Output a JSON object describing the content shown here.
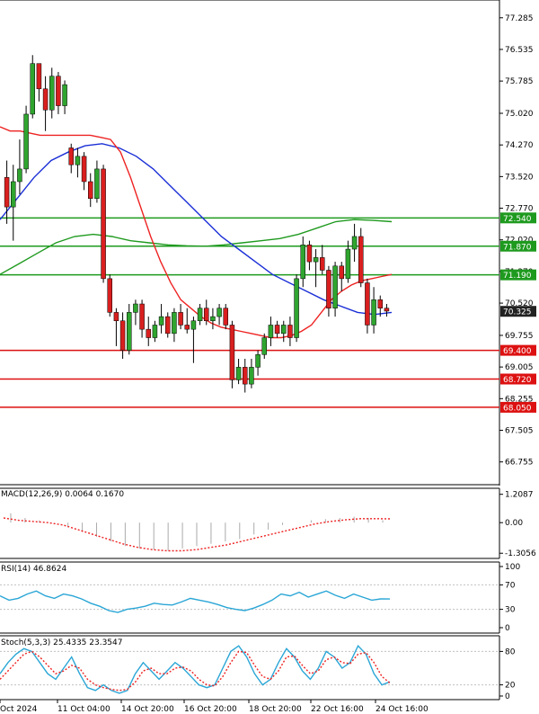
{
  "chart_data": [
    {
      "type": "candlestick",
      "panel": "price",
      "y_ticks": [
        "77.285",
        "76.535",
        "75.785",
        "75.020",
        "74.270",
        "73.520",
        "72.770",
        "72.020",
        "71.270",
        "70.520",
        "69.755",
        "69.005",
        "68.255",
        "67.505",
        "66.755"
      ],
      "ylim": [
        66.3,
        77.6
      ],
      "current_price": {
        "value": 70.325,
        "label": "70.325"
      },
      "support_lines": [
        {
          "value": 69.4,
          "label": "69.400"
        },
        {
          "value": 68.72,
          "label": "68.720"
        },
        {
          "value": 68.05,
          "label": "68.050"
        }
      ],
      "resistance_lines": [
        {
          "value": 72.54,
          "label": "72.540"
        },
        {
          "value": 71.87,
          "label": "71.870"
        },
        {
          "value": 71.19,
          "label": "71.190"
        }
      ],
      "candles": [
        [
          73.5,
          73.9,
          72.4,
          72.8
        ],
        [
          72.8,
          73.8,
          72.0,
          73.4
        ],
        [
          73.4,
          74.4,
          73.1,
          73.7
        ],
        [
          73.7,
          75.2,
          73.6,
          75.0
        ],
        [
          75.0,
          76.4,
          74.9,
          76.2
        ],
        [
          76.2,
          76.2,
          75.3,
          75.6
        ],
        [
          75.6,
          75.9,
          74.6,
          75.1
        ],
        [
          75.1,
          76.1,
          74.9,
          75.9
        ],
        [
          75.9,
          76.0,
          75.0,
          75.2
        ],
        [
          75.2,
          75.8,
          75.0,
          75.7
        ],
        [
          74.2,
          74.3,
          73.6,
          73.8
        ],
        [
          73.8,
          74.2,
          73.5,
          74.0
        ],
        [
          74.0,
          74.1,
          73.2,
          73.4
        ],
        [
          73.4,
          73.6,
          72.8,
          73.0
        ],
        [
          73.0,
          73.9,
          72.9,
          73.7
        ],
        [
          73.7,
          73.8,
          71.0,
          71.1
        ],
        [
          71.1,
          71.2,
          70.2,
          70.3
        ],
        [
          70.3,
          70.4,
          69.5,
          70.1
        ],
        [
          70.1,
          70.3,
          69.2,
          69.4
        ],
        [
          69.4,
          70.5,
          69.3,
          70.3
        ],
        [
          70.3,
          70.6,
          70.0,
          70.5
        ],
        [
          70.5,
          70.6,
          69.7,
          69.9
        ],
        [
          69.9,
          70.2,
          69.5,
          69.7
        ],
        [
          69.7,
          70.1,
          69.6,
          70.0
        ],
        [
          70.0,
          70.5,
          69.8,
          70.2
        ],
        [
          70.2,
          70.3,
          69.7,
          69.8
        ],
        [
          69.8,
          70.4,
          69.6,
          70.3
        ],
        [
          70.3,
          70.5,
          69.9,
          70.0
        ],
        [
          70.0,
          70.4,
          69.8,
          69.9
        ],
        [
          69.9,
          70.2,
          69.1,
          70.1
        ],
        [
          70.1,
          70.5,
          70.0,
          70.4
        ],
        [
          70.4,
          70.6,
          70.0,
          70.1
        ],
        [
          70.1,
          70.4,
          69.9,
          70.2
        ],
        [
          70.2,
          70.5,
          70.0,
          70.4
        ],
        [
          70.4,
          70.5,
          69.9,
          70.0
        ],
        [
          70.0,
          70.1,
          68.5,
          68.7
        ],
        [
          68.7,
          69.2,
          68.6,
          69.0
        ],
        [
          69.0,
          69.2,
          68.4,
          68.6
        ],
        [
          68.6,
          69.2,
          68.5,
          69.0
        ],
        [
          69.0,
          69.4,
          68.8,
          69.3
        ],
        [
          69.3,
          69.8,
          69.2,
          69.7
        ],
        [
          69.7,
          70.2,
          69.5,
          70.0
        ],
        [
          70.0,
          70.1,
          69.7,
          69.8
        ],
        [
          69.8,
          70.1,
          69.6,
          70.0
        ],
        [
          70.0,
          70.2,
          69.5,
          69.7
        ],
        [
          69.7,
          71.2,
          69.6,
          71.1
        ],
        [
          71.1,
          72.1,
          70.9,
          71.9
        ],
        [
          71.9,
          72.0,
          71.3,
          71.5
        ],
        [
          71.5,
          71.8,
          70.9,
          71.6
        ],
        [
          71.6,
          71.9,
          71.2,
          71.3
        ],
        [
          71.3,
          71.4,
          70.2,
          70.4
        ],
        [
          70.4,
          71.5,
          70.2,
          71.4
        ],
        [
          71.4,
          71.5,
          70.8,
          71.1
        ],
        [
          71.1,
          72.0,
          71.0,
          71.8
        ],
        [
          71.8,
          72.4,
          71.5,
          72.1
        ],
        [
          72.1,
          72.3,
          70.9,
          71.0
        ],
        [
          71.0,
          71.1,
          69.8,
          70.0
        ],
        [
          70.0,
          70.9,
          69.8,
          70.6
        ],
        [
          70.6,
          70.7,
          70.2,
          70.4
        ],
        [
          70.4,
          70.5,
          70.2,
          70.33
        ]
      ],
      "ma_red": [
        74.7,
        74.6,
        74.6,
        74.55,
        74.5,
        74.5,
        74.5,
        74.5,
        74.5,
        74.5,
        74.45,
        74.4,
        74.1,
        73.5,
        72.8,
        72.1,
        71.5,
        71.0,
        70.6,
        70.4,
        70.2,
        70.05,
        69.95,
        69.9,
        69.85,
        69.8,
        69.75,
        69.7,
        69.7,
        69.75,
        69.85,
        70.0,
        70.3,
        70.6,
        70.8,
        70.95,
        71.05,
        71.1,
        71.15,
        71.2
      ],
      "ma_blue": [
        72.5,
        73.0,
        73.5,
        73.9,
        74.1,
        74.25,
        74.3,
        74.2,
        74.0,
        73.7,
        73.3,
        72.9,
        72.5,
        72.1,
        71.8,
        71.5,
        71.2,
        71.0,
        70.8,
        70.6,
        70.45,
        70.3,
        70.25,
        70.3
      ],
      "ma_green": [
        71.2,
        71.45,
        71.7,
        71.95,
        72.1,
        72.15,
        72.1,
        72.0,
        71.95,
        71.9,
        71.88,
        71.87,
        71.9,
        71.95,
        72.0,
        72.05,
        72.15,
        72.3,
        72.45,
        72.5,
        72.48,
        72.45
      ]
    },
    {
      "type": "histogram",
      "panel": "macd",
      "label": "MACD(12,26,9) 0.0064 0.1670",
      "y_ticks": [
        "1.2087",
        "0.00",
        "-1.3056"
      ],
      "ylim": [
        -1.45,
        1.35
      ],
      "histogram": [
        0.4,
        0.2,
        0.1,
        0.0,
        -0.2,
        -0.4,
        -0.6,
        -0.8,
        -1.0,
        -1.1,
        -1.15,
        -1.2,
        -1.1,
        -1.0,
        -0.9,
        -0.8,
        -0.7,
        -0.5,
        -0.3,
        -0.1,
        0.0,
        0.1,
        0.15,
        0.2,
        0.25,
        0.2,
        0.1
      ],
      "signal": [
        0.2,
        0.1,
        0.05,
        0.0,
        -0.1,
        -0.3,
        -0.5,
        -0.7,
        -0.9,
        -1.05,
        -1.15,
        -1.2,
        -1.2,
        -1.15,
        -1.05,
        -0.95,
        -0.8,
        -0.65,
        -0.5,
        -0.35,
        -0.2,
        -0.05,
        0.05,
        0.12,
        0.17,
        0.17,
        0.16
      ]
    },
    {
      "type": "line",
      "panel": "rsi",
      "label": "RSI(14) 46.8624",
      "y_ticks": [
        "100",
        "70",
        "30",
        "0"
      ],
      "ylim": [
        0,
        100
      ],
      "values": [
        52,
        45,
        48,
        55,
        60,
        52,
        48,
        55,
        52,
        47,
        40,
        35,
        28,
        25,
        30,
        32,
        35,
        40,
        38,
        37,
        42,
        48,
        45,
        42,
        38,
        33,
        30,
        28,
        32,
        38,
        45,
        55,
        52,
        58,
        50,
        55,
        60,
        53,
        48,
        55,
        50,
        45,
        47,
        46.86
      ]
    },
    {
      "type": "line",
      "panel": "stoch",
      "label": "Stoch(5,3,3) 25.4335 23.3547",
      "y_ticks": [
        "80",
        "20",
        "0"
      ],
      "ylim": [
        0,
        100
      ],
      "main": [
        40,
        60,
        75,
        85,
        80,
        60,
        40,
        30,
        50,
        70,
        40,
        15,
        10,
        20,
        10,
        5,
        10,
        40,
        60,
        45,
        30,
        45,
        60,
        50,
        35,
        20,
        15,
        20,
        50,
        80,
        90,
        70,
        40,
        20,
        30,
        60,
        85,
        70,
        45,
        30,
        50,
        80,
        70,
        50,
        60,
        90,
        75,
        40,
        20,
        25.43
      ],
      "signal": [
        30,
        45,
        60,
        75,
        80,
        70,
        55,
        40,
        45,
        55,
        50,
        30,
        20,
        15,
        12,
        10,
        12,
        25,
        45,
        50,
        40,
        40,
        50,
        52,
        45,
        30,
        20,
        18,
        35,
        60,
        80,
        78,
        55,
        35,
        30,
        45,
        70,
        72,
        55,
        40,
        45,
        65,
        70,
        60,
        58,
        75,
        78,
        60,
        35,
        23.35
      ]
    }
  ],
  "x_axis": {
    "labels": [
      "Oct 2024",
      "11 Oct 04:00",
      "14 Oct 20:00",
      "16 Oct 20:00",
      "18 Oct 20:00",
      "22 Oct 16:00",
      "24 Oct 16:00"
    ]
  },
  "colors": {
    "bull": "#2fa52f",
    "bear": "#d91f1f",
    "ma_red": "#ee2222",
    "ma_blue": "#1a2fd6",
    "ma_green": "#1f9a1f",
    "support": "#dd1111",
    "resistance": "#1e9a1e",
    "price_tag": "#222222"
  }
}
